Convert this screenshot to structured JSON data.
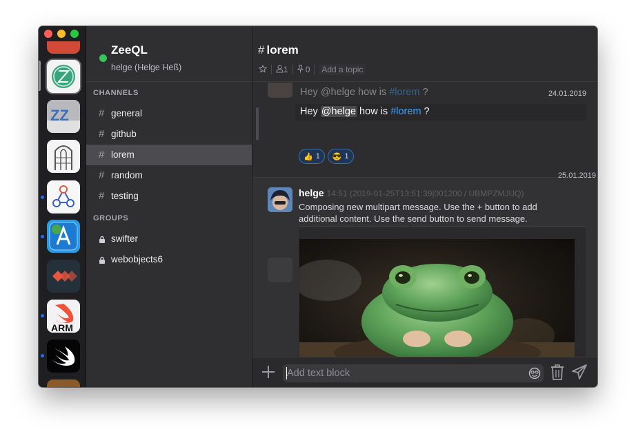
{
  "workspace": {
    "name": "ZeeQL",
    "user": "helge (Helge Heß)",
    "status_color": "#33c75a"
  },
  "sections": {
    "channels_title": "CHANNELS",
    "groups_title": "GROUPS"
  },
  "channels": [
    {
      "name": "general"
    },
    {
      "name": "github"
    },
    {
      "name": "lorem",
      "selected": true
    },
    {
      "name": "random"
    },
    {
      "name": "testing"
    }
  ],
  "groups": [
    {
      "name": "swifter"
    },
    {
      "name": "webobjects6"
    }
  ],
  "channel_header": {
    "hash": "#",
    "title": "lorem",
    "members": "1",
    "pins": "0",
    "topic_placeholder": "Add a topic"
  },
  "messages": {
    "date1": "24.01.2019",
    "prev_text_a": "Hey ",
    "prev_mention": "@helge",
    "prev_text_b": " how is ",
    "prev_channel": "#lorem",
    "prev_text_c": " ?",
    "msg_text_a": "Hey ",
    "msg_mention": "@helge",
    "msg_text_b": " how is ",
    "msg_channel": "#lorem",
    "msg_text_c": " ?",
    "reaction1_emoji": "👍",
    "reaction1_count": "1",
    "reaction2_emoji": "😎",
    "reaction2_count": "1",
    "date2": "25.01.2019",
    "author": "helge",
    "timestamp": "14:51 (2019-01-25T13:51:39|001200 / UBMPZMJUQ)",
    "body": "Composing new multipart message. Use the + button to add additional content. Use the send button to send message."
  },
  "composer": {
    "placeholder": "Add text block"
  },
  "colors": {
    "accent": "#3ea1ff",
    "unread": "#1e6bff",
    "selected_channel": "#4c4c50"
  },
  "icons": [
    "hash-icon",
    "lock-icon",
    "star-icon",
    "person-icon",
    "pin-icon",
    "plus-icon",
    "emoji-icon",
    "trash-icon",
    "send-icon"
  ]
}
